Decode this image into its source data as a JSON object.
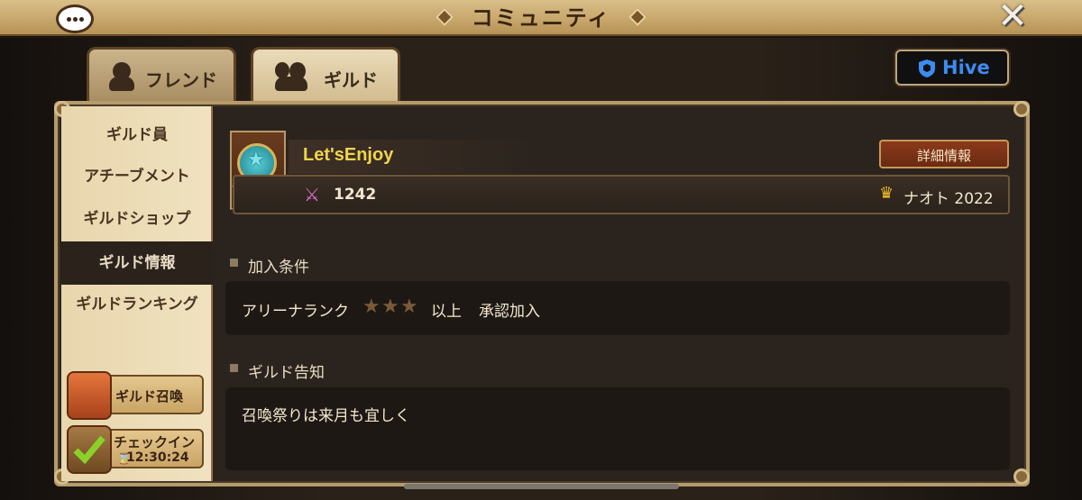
{
  "header": {
    "title": "コミュニティ"
  },
  "tabs": [
    {
      "label": "フレンド",
      "active": false
    },
    {
      "label": "ギルド",
      "active": true
    }
  ],
  "hive": {
    "label": "Hive"
  },
  "sidebar": {
    "items": [
      {
        "label": "ギルド員"
      },
      {
        "label": "アチーブメント"
      },
      {
        "label": "ギルドショップ"
      },
      {
        "label": "ギルド情報",
        "active": true
      },
      {
        "label": "ギルドランキング"
      }
    ],
    "summon_button": "ギルド召喚",
    "checkin": {
      "label": "チェックイン",
      "timer": "12:30:24"
    }
  },
  "guild": {
    "name": "Let'sEnjoy",
    "detail_button": "詳細情報",
    "points": "1242",
    "leader": "ナオト 2022"
  },
  "requirements": {
    "title": "加入条件",
    "arena_rank_label": "アリーナランク",
    "stars": 3,
    "suffix": "以上",
    "join_type": "承認加入"
  },
  "notice": {
    "title": "ギルド告知",
    "text": "召喚祭りは来月も宜しく"
  },
  "colors": {
    "accent_gold": "#f0d54a",
    "frame": "#b59a6b",
    "hive_blue": "#3e8bf0"
  }
}
